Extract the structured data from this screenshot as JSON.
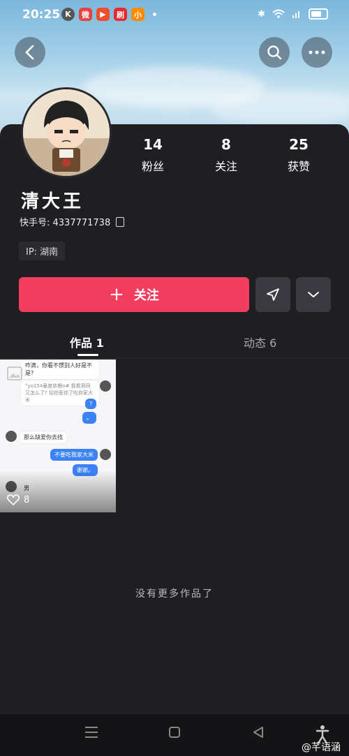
{
  "status": {
    "time": "20:25",
    "app_badges": [
      "K",
      "微",
      "▶",
      "刷",
      "小"
    ]
  },
  "header": {
    "back_icon": "back-arrow-icon",
    "search_icon": "search-icon",
    "more_icon": "more-dots-icon"
  },
  "profile": {
    "stats": [
      {
        "value": "14",
        "label": "粉丝"
      },
      {
        "value": "8",
        "label": "关注"
      },
      {
        "value": "25",
        "label": "获赞"
      }
    ],
    "name": "清大王",
    "kuaishou_id": "快手号: 4337771738",
    "ip": "IP: 湖南"
  },
  "actions": {
    "follow_label": "关注",
    "follow_plus": "+"
  },
  "tabs": [
    {
      "label": "作品 1",
      "active": true
    },
    {
      "label": "动态 6",
      "active": false
    }
  ],
  "post": {
    "chat": [
      {
        "side": "left",
        "text": "咋滴，你看不惯别人好是不是?"
      },
      {
        "side": "left",
        "text": "°yo154垂度依赖o# 我看男同又怎么了? 招你惹你了吃你家大米"
      },
      {
        "side": "right",
        "text": "?"
      },
      {
        "side": "right",
        "text": "。"
      },
      {
        "side": "left",
        "text": "那么缺爱你去找"
      },
      {
        "side": "right",
        "text": "不要吃我家大米"
      },
      {
        "side": "right",
        "text": "谢谢。"
      },
      {
        "side": "left",
        "text": "男"
      }
    ],
    "likes": "8"
  },
  "empty_message": "没有更多作品了",
  "watermark": "@芊语涵",
  "colors": {
    "accent": "#f23d5e",
    "panel": "#1e1e23"
  }
}
